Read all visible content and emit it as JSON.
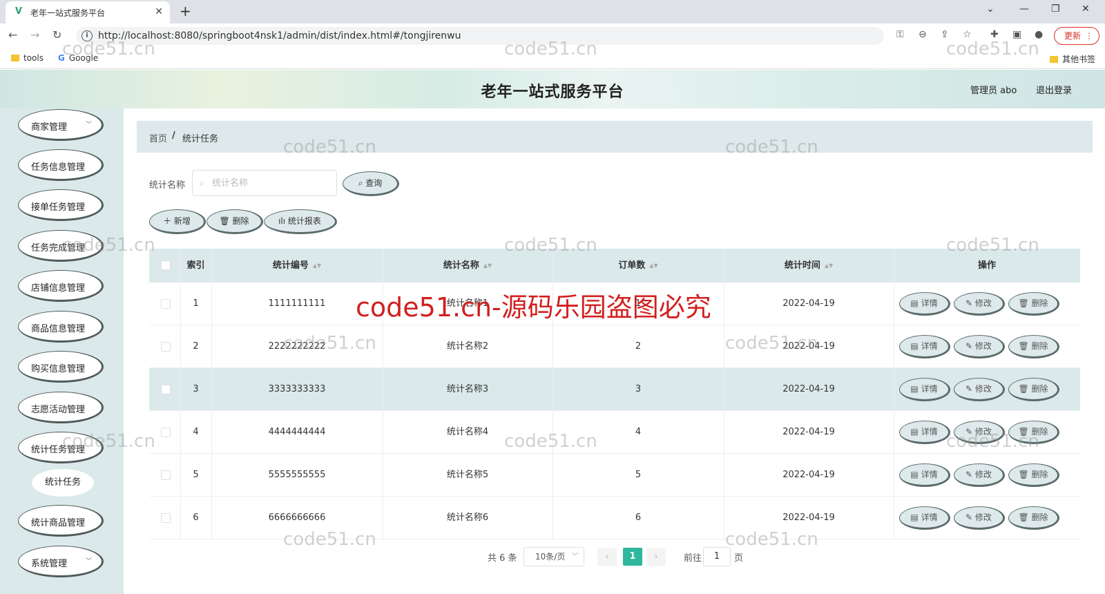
{
  "browser": {
    "tab_title": "老年一站式服务平台",
    "favicon": "V",
    "url": "http://localhost:8080/springboot4nsk1/admin/dist/index.html#/tongjirenwu",
    "update_label": "更新",
    "bookmarks": [
      {
        "label": "tools",
        "icon": "folder-icon"
      },
      {
        "label": "Google",
        "icon": "google-icon"
      }
    ],
    "other_bookmarks": "其他书签"
  },
  "header": {
    "title": "老年一站式服务平台",
    "user": "管理员 abo",
    "logout": "退出登录"
  },
  "sidebar": {
    "items": [
      {
        "label": "商家管理",
        "has_chevron": true
      },
      {
        "label": "任务信息管理"
      },
      {
        "label": "接单任务管理"
      },
      {
        "label": "任务完成管理"
      },
      {
        "label": "店铺信息管理"
      },
      {
        "label": "商品信息管理"
      },
      {
        "label": "购买信息管理"
      },
      {
        "label": "志愿活动管理"
      },
      {
        "label": "统计任务管理"
      },
      {
        "label": "统计商品管理"
      },
      {
        "label": "系统管理",
        "has_chevron": true
      }
    ],
    "sub_item": "统计任务"
  },
  "breadcrumb": {
    "home": "首页",
    "separator": "/",
    "current": "统计任务"
  },
  "search": {
    "label": "统计名称",
    "placeholder": "统计名称",
    "value": "",
    "button": "查询"
  },
  "actions": {
    "add": "新增",
    "delete": "删除",
    "report": "统计报表"
  },
  "table": {
    "columns": [
      "索引",
      "统计编号",
      "统计名称",
      "订单数",
      "统计时间",
      "操作"
    ],
    "highlighted_row": 3,
    "rows": [
      {
        "index": "1",
        "code": "1111111111",
        "name": "统计名称1",
        "orders": "1",
        "time": "2022-04-19"
      },
      {
        "index": "2",
        "code": "2222222222",
        "name": "统计名称2",
        "orders": "2",
        "time": "2022-04-19"
      },
      {
        "index": "3",
        "code": "3333333333",
        "name": "统计名称3",
        "orders": "3",
        "time": "2022-04-19"
      },
      {
        "index": "4",
        "code": "4444444444",
        "name": "统计名称4",
        "orders": "4",
        "time": "2022-04-19"
      },
      {
        "index": "5",
        "code": "5555555555",
        "name": "统计名称5",
        "orders": "5",
        "time": "2022-04-19"
      },
      {
        "index": "6",
        "code": "6666666666",
        "name": "统计名称6",
        "orders": "6",
        "time": "2022-04-19"
      }
    ],
    "row_actions": {
      "detail": "详情",
      "edit": "修改",
      "delete": "删除"
    }
  },
  "pagination": {
    "total": "共 6 条",
    "page_size": "10条/页",
    "current_page": "1",
    "goto_label": "前往",
    "goto_value": "1",
    "page_suffix": "页"
  },
  "watermark": {
    "small": "code51.cn",
    "big": "code51.cn-源码乐园盗图必究"
  },
  "colors": {
    "accent": "#2fb69e",
    "panel": "#dbe9ea",
    "watermark_red": "#d21f1f"
  }
}
